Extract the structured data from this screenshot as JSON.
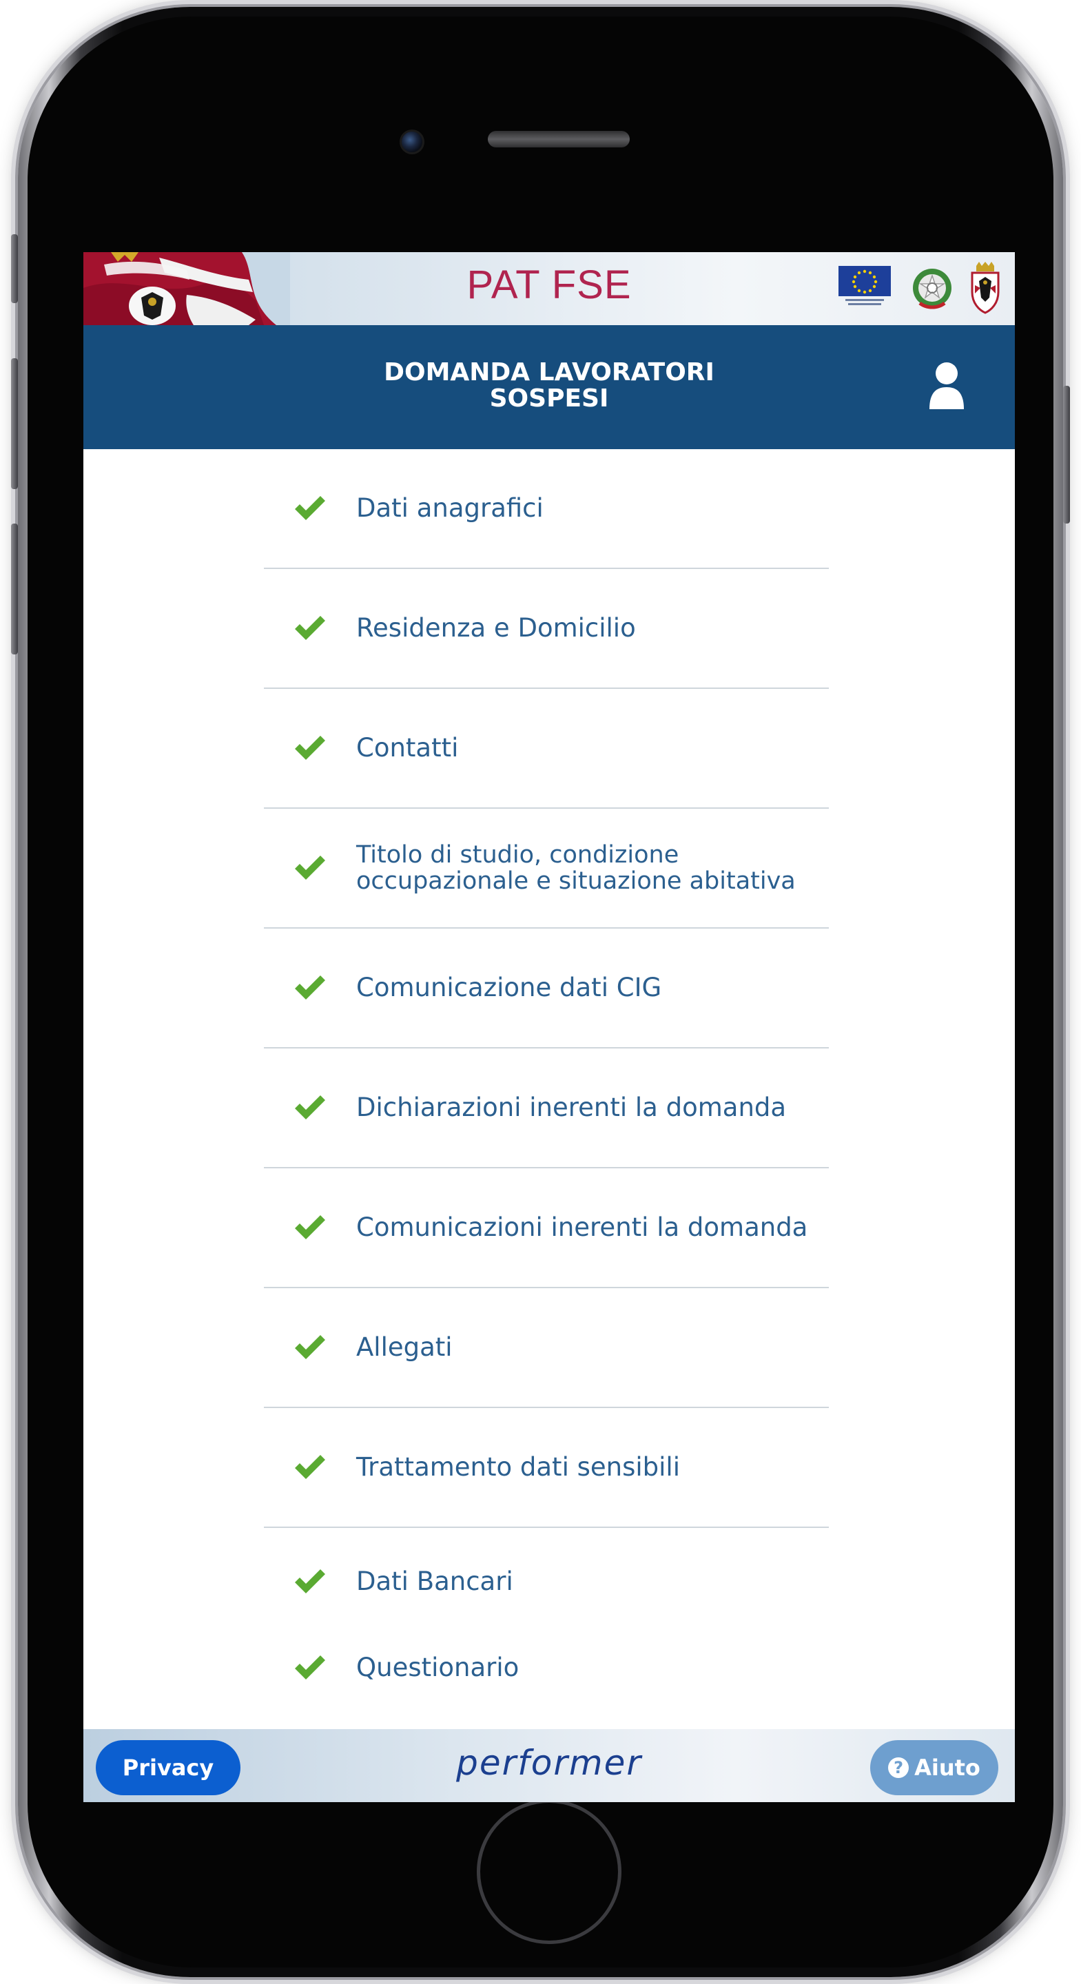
{
  "banner": {
    "title": "PAT FSE"
  },
  "header": {
    "title_line1": "DOMANDA LAVORATORI",
    "title_line2": "SOSPESI"
  },
  "menu": {
    "items": [
      {
        "label": "Dati anagrafici",
        "status": "complete"
      },
      {
        "label": "Residenza e Domicilio",
        "status": "complete"
      },
      {
        "label": "Contatti",
        "status": "complete"
      },
      {
        "label_line1": "Titolo di studio, condizione",
        "label_line2": "occupazionale e situazione abitativa",
        "status": "complete"
      },
      {
        "label": "Comunicazione dati CIG",
        "status": "complete"
      },
      {
        "label": "Dichiarazioni inerenti la domanda",
        "status": "complete"
      },
      {
        "label": "Comunicazioni inerenti la domanda",
        "status": "complete"
      },
      {
        "label": "Allegati",
        "status": "complete"
      },
      {
        "label": "Trattamento dati sensibili",
        "status": "complete"
      },
      {
        "label": "Dati Bancari",
        "status": "complete"
      },
      {
        "label": "Questionario",
        "status": "complete"
      }
    ]
  },
  "footer": {
    "privacy_label": "Privacy",
    "brand": "performer",
    "help_label": "Aiuto",
    "help_icon": "?"
  },
  "colors": {
    "header_bg": "#164d7d",
    "check": "#5aaa32",
    "link_text": "#2b5f8f",
    "title_red": "#b0244f",
    "privacy_btn": "#0c5fd0",
    "help_btn": "#6e9fcf"
  },
  "icons": {
    "user": "user-icon",
    "check": "check-icon",
    "help": "question-circle-icon"
  }
}
